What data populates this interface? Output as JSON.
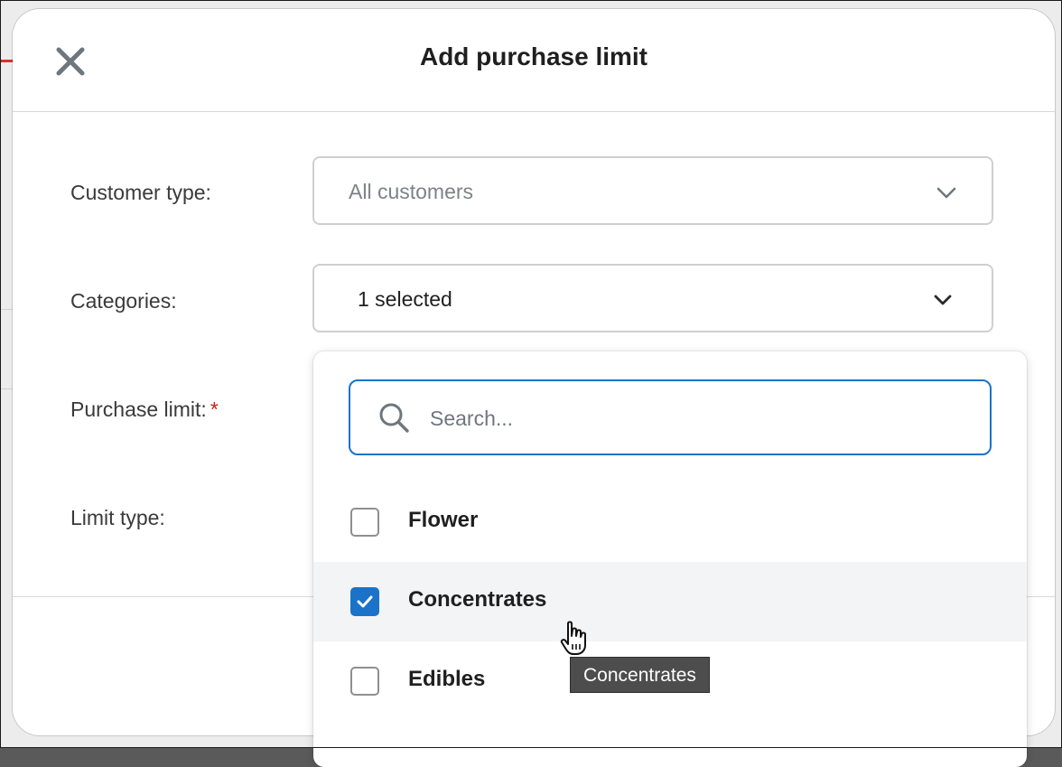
{
  "modal": {
    "title": "Add purchase limit"
  },
  "form": {
    "customer_type": {
      "label": "Customer type:",
      "value": "All customers"
    },
    "categories": {
      "label": "Categories:",
      "value": "1 selected"
    },
    "purchase_limit": {
      "label": "Purchase limit:",
      "required_marker": "*"
    },
    "limit_type": {
      "label": "Limit type:"
    }
  },
  "dropdown": {
    "search_placeholder": "Search...",
    "options": [
      {
        "label": "Flower",
        "checked": false
      },
      {
        "label": "Concentrates",
        "checked": true
      },
      {
        "label": "Edibles",
        "checked": false
      }
    ]
  },
  "tooltip": {
    "text": "Concentrates"
  },
  "colors": {
    "accent": "#1a73c9",
    "required": "#d01a1a",
    "hover_row": "#f3f4f6",
    "tooltip_bg": "#4d4d4d"
  },
  "icons": {
    "close": "close-icon",
    "chevron": "chevron-down-icon",
    "search": "search-icon",
    "check": "check-icon",
    "cursor": "hand-pointer-icon"
  }
}
